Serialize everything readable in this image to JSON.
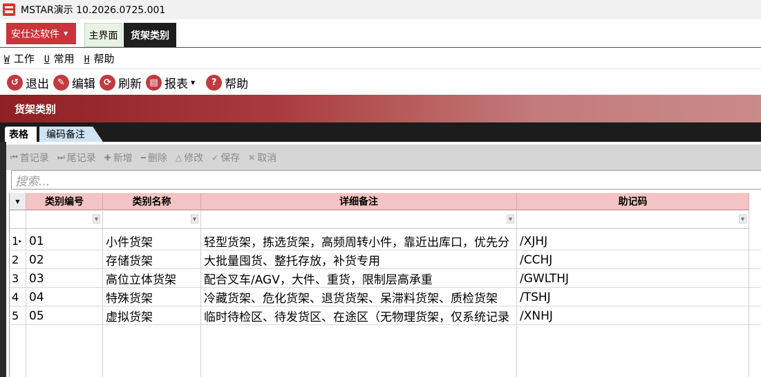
{
  "window": {
    "title": "MSTAR演示   10.2026.0725.001"
  },
  "modules": {
    "brand_label": "安仕达软件",
    "tabs": [
      {
        "label": "主界面"
      },
      {
        "label": "货架类别"
      }
    ]
  },
  "menu": [
    {
      "key": "W",
      "label": "工作"
    },
    {
      "key": "U",
      "label": "常用"
    },
    {
      "key": "H",
      "label": "帮助"
    }
  ],
  "toolbar": {
    "exit": "退出",
    "edit": "编辑",
    "refresh": "刷新",
    "report": "报表",
    "help": "帮助"
  },
  "page": {
    "title": "货架类别"
  },
  "subtabs": [
    {
      "label": "表格"
    },
    {
      "label": "编码备注"
    }
  ],
  "nav": {
    "first": "首记录",
    "last": "尾记录",
    "add": "新增",
    "delete": "删除",
    "modify": "修改",
    "save": "保存",
    "cancel": "取消"
  },
  "search": {
    "placeholder": "搜索..."
  },
  "table": {
    "headers": [
      "类别编号",
      "类别名称",
      "详细备注",
      "助记码"
    ],
    "rows": [
      {
        "n": "1",
        "code": "01",
        "name": "小件货架",
        "note": "轻型货架，拣选货架，高频周转小件，靠近出库口，优先分",
        "mnemonic": "/XJHJ"
      },
      {
        "n": "2",
        "code": "02",
        "name": "存储货架",
        "note": "大批量囤货、整托存放，补货专用",
        "mnemonic": "/CCHJ"
      },
      {
        "n": "3",
        "code": "03",
        "name": "高位立体货架",
        "note": "配合叉车/AGV，大件、重货，限制层高承重",
        "mnemonic": "/GWLTHJ"
      },
      {
        "n": "4",
        "code": "04",
        "name": "特殊货架",
        "note": "冷藏货架、危化货架、退货货架、呆滞料货架、质检货架",
        "mnemonic": "/TSHJ"
      },
      {
        "n": "5",
        "code": "05",
        "name": "虚拟货架",
        "note": "临时待检区、待发货区、在途区（无物理货架，仅系统记录",
        "mnemonic": "/XNHJ"
      }
    ]
  },
  "colors": {
    "accent": "#c9353a",
    "header_pink": "#f4c3c3",
    "band_dark": "#8f1f23"
  }
}
